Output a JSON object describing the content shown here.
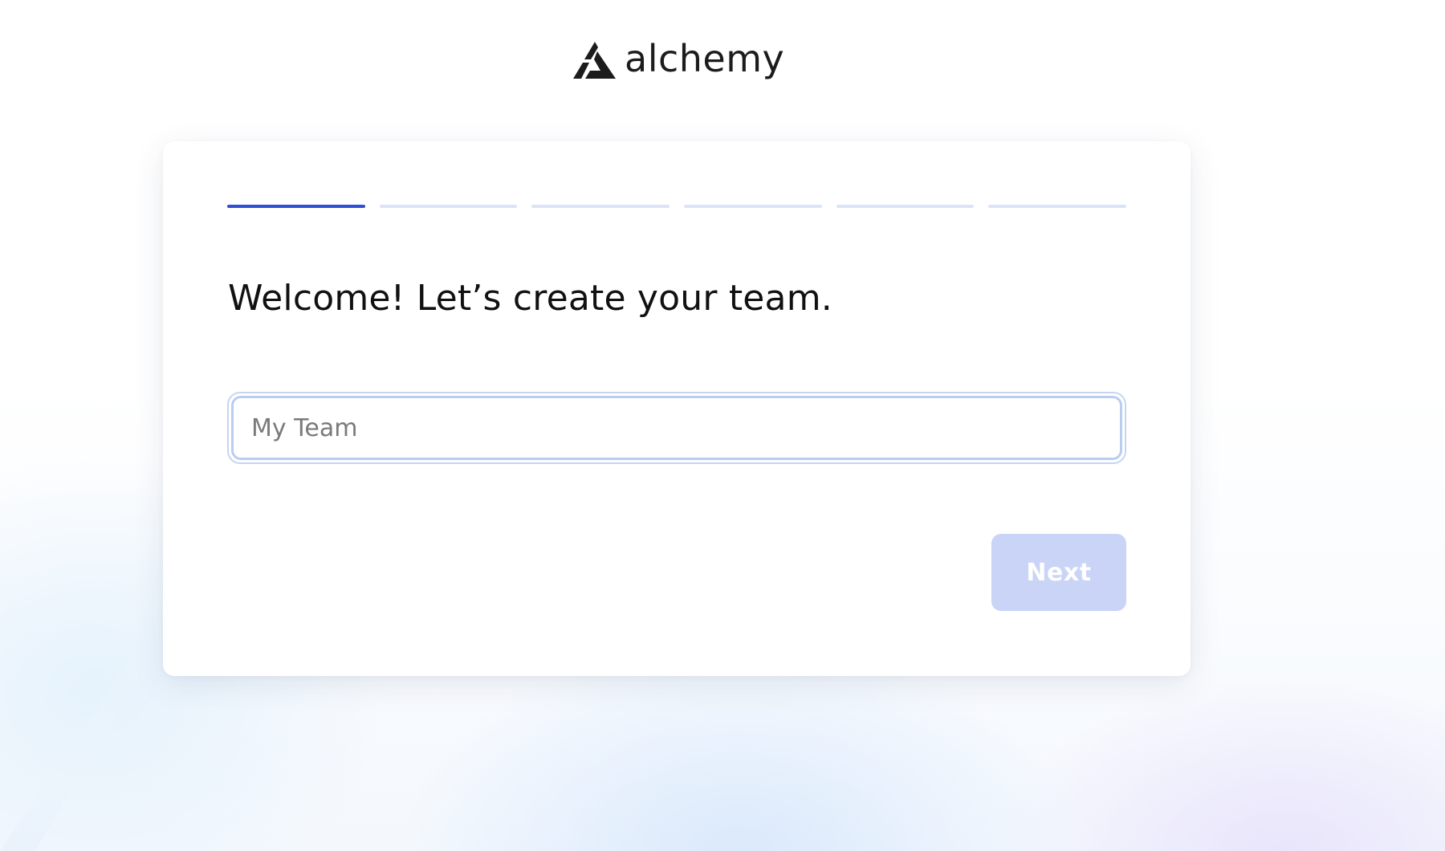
{
  "brand": {
    "name": "alchemy",
    "logo_icon": "alchemy-logo-icon"
  },
  "onboarding": {
    "total_steps": 6,
    "current_step": 1,
    "heading": "Welcome! Let’s create your team.",
    "team_name_input": {
      "value": "",
      "placeholder": "My Team"
    },
    "next_button": {
      "label": "Next",
      "enabled": false
    }
  },
  "colors": {
    "accent": "#2f4fd6",
    "step_inactive": "#dbe4f7",
    "button_disabled": "#c9d4f6",
    "input_focus_ring": "#b9cdf2"
  }
}
